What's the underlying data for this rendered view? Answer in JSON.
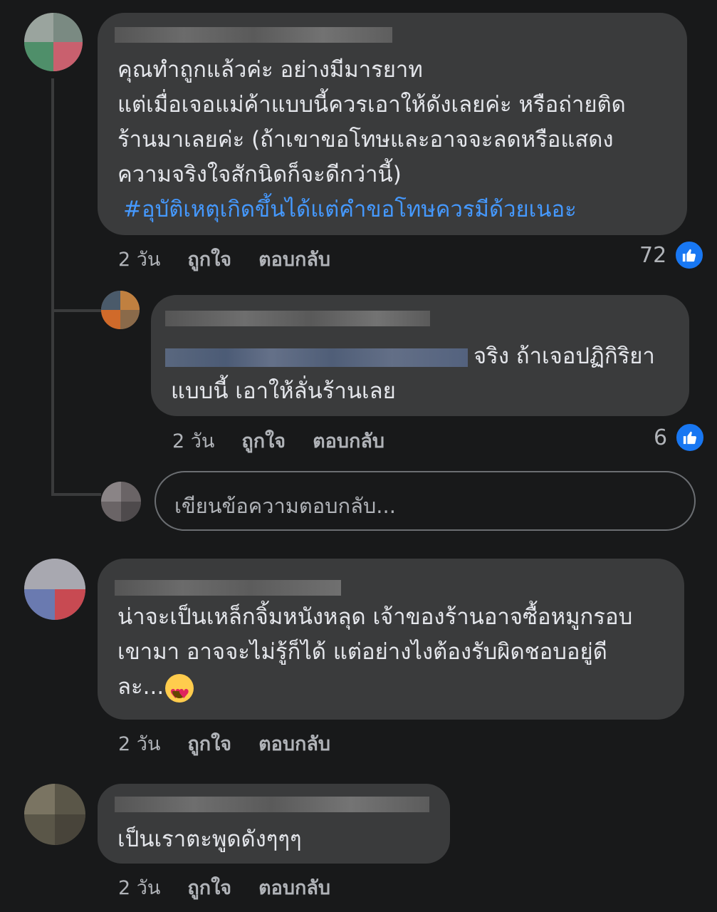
{
  "comments": [
    {
      "text_lines": [
        "คุณทำถูกแล้วค่ะ อย่างมีมารยาท",
        "แต่เมื่อเจอแม่ค้าแบบนี้ควรเอาให้ดังเลยค่ะ หรือถ่ายติด",
        "ร้านมาเลยค่ะ (ถ้าเขาขอโทษและอาจจะลดหรือแสดง",
        "ความจริงใจสักนิดก็จะดีกว่านี้)"
      ],
      "hashtag": "#อุบัติเหตุเกิดขึ้นได้แต่คำขอโทษควรมีด้วยเนอะ",
      "time": "2 วัน",
      "like_label": "ถูกใจ",
      "reply_label": "ตอบกลับ",
      "like_count": "72"
    },
    {
      "text_line1": "จริง ถ้าเจอปฏิกิริยา",
      "text_line2": "แบบนี้ เอาให้ลั่นร้านเลย",
      "time": "2 วัน",
      "like_label": "ถูกใจ",
      "reply_label": "ตอบกลับ",
      "like_count": "6"
    },
    {
      "text_lines": [
        "น่าจะเป็นเหล็กจิ้มหนังหลุด เจ้าของร้านอาจซื้อหมูกรอบ",
        "เขามา อาจจะไม่รู้ก็ได้ แต่อย่างไงต้องรับผิดชอบอยู่ดี",
        "ละ..."
      ],
      "emoji": "heart-eyes-emoji",
      "time": "2 วัน",
      "like_label": "ถูกใจ",
      "reply_label": "ตอบกลับ"
    },
    {
      "text": "เป็นเราตะพูดดังๆๆๆ",
      "time": "2 วัน",
      "like_label": "ถูกใจ",
      "reply_label": "ตอบกลับ"
    }
  ],
  "reply_input": {
    "placeholder": "เขียนข้อความตอบกลับ..."
  },
  "colors": {
    "background": "#18191a",
    "bubble": "#3a3b3c",
    "hashtag": "#4599ff",
    "like_badge": "#1877f2"
  }
}
